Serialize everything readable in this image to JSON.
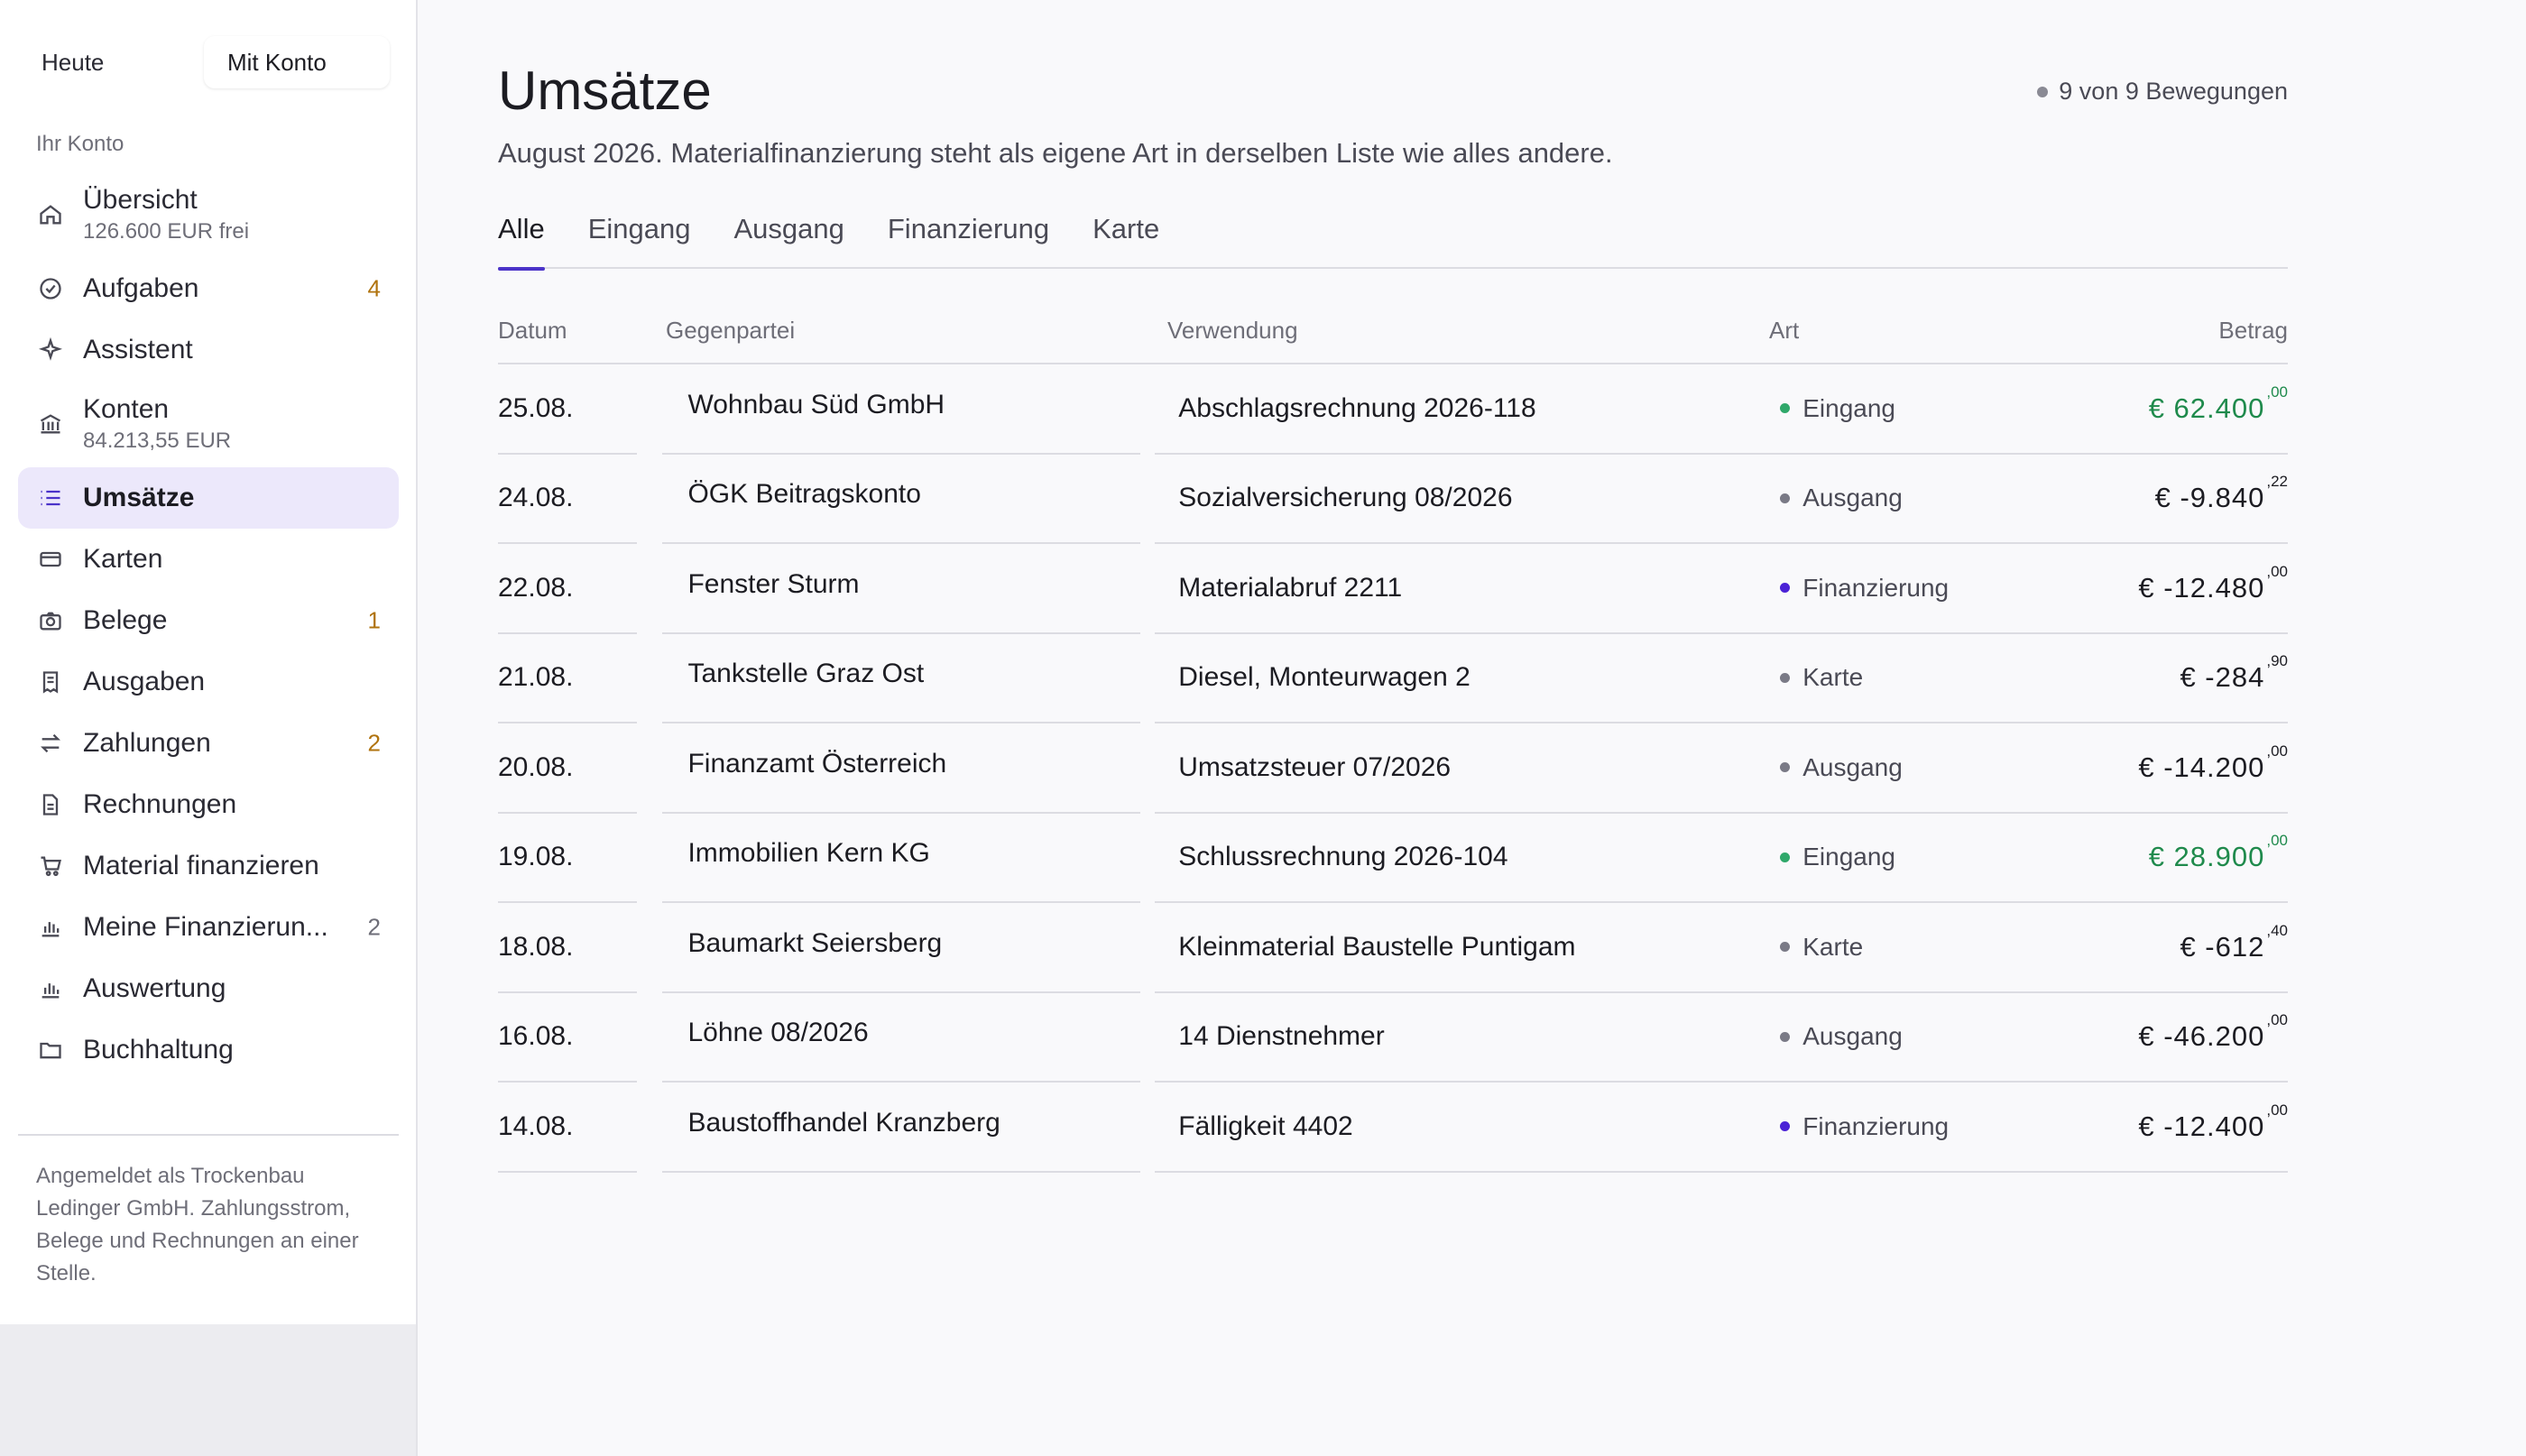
{
  "colors": {
    "accent": "#4b33c9",
    "positive": "#1f8a4c",
    "badge": "#b0730e",
    "dot_eingang": "#2fa86a",
    "dot_ausgang": "#7a7a86",
    "dot_finanzierung": "#4b22d6",
    "dot_karte": "#7a7a86"
  },
  "sidebar": {
    "mode": {
      "today": "Heute",
      "with_account": "Mit Konto"
    },
    "section_label": "Ihr Konto",
    "items": [
      {
        "label": "Übersicht",
        "sub": "126.600 EUR frei",
        "badge": "",
        "icon": "home-icon"
      },
      {
        "label": "Aufgaben",
        "sub": "",
        "badge": "4",
        "icon": "check-circle-icon"
      },
      {
        "label": "Assistent",
        "sub": "",
        "badge": "",
        "icon": "sparkle-icon"
      },
      {
        "label": "Konten",
        "sub": "84.213,55 EUR",
        "badge": "",
        "icon": "bank-icon"
      },
      {
        "label": "Umsätze",
        "sub": "",
        "badge": "",
        "icon": "list-icon"
      },
      {
        "label": "Karten",
        "sub": "",
        "badge": "",
        "icon": "card-icon"
      },
      {
        "label": "Belege",
        "sub": "",
        "badge": "1",
        "icon": "camera-icon"
      },
      {
        "label": "Ausgaben",
        "sub": "",
        "badge": "",
        "icon": "receipt-icon"
      },
      {
        "label": "Zahlungen",
        "sub": "",
        "badge": "2",
        "icon": "transfer-icon"
      },
      {
        "label": "Rechnungen",
        "sub": "",
        "badge": "",
        "icon": "document-icon"
      },
      {
        "label": "Material finanzieren",
        "sub": "",
        "badge": "",
        "icon": "cart-icon"
      },
      {
        "label": "Meine Finanzierun...",
        "sub": "",
        "badge": "2",
        "icon": "bar-chart-icon"
      },
      {
        "label": "Auswertung",
        "sub": "",
        "badge": "",
        "icon": "bar-chart-icon"
      },
      {
        "label": "Buchhaltung",
        "sub": "",
        "badge": "",
        "icon": "folder-icon"
      }
    ],
    "note": "Angemeldet als Trockenbau Ledinger GmbH. Zahlungsstrom, Belege und Rechnungen an einer Stelle."
  },
  "main": {
    "title": "Umsätze",
    "count": "9 von 9 Bewegungen",
    "subtitle": "August 2026. Materialfinanzierung steht als eigene Art in derselben Liste wie alles andere.",
    "tabs": [
      "Alle",
      "Eingang",
      "Ausgang",
      "Finanzierung",
      "Karte"
    ],
    "columns": {
      "date": "Datum",
      "party": "Gegenpartei",
      "purpose": "Verwendung",
      "type": "Art",
      "amount": "Betrag"
    },
    "rows": [
      {
        "date": "25.08.",
        "party": "Wohnbau Süd GmbH",
        "purpose": "Abschlagsrechnung 2026-118",
        "type": "Eingang",
        "amount": "€ 62.400",
        "cents": ",00"
      },
      {
        "date": "24.08.",
        "party": "ÖGK Beitragskonto",
        "purpose": "Sozialversicherung 08/2026",
        "type": "Ausgang",
        "amount": "€ -9.840",
        "cents": ",22"
      },
      {
        "date": "22.08.",
        "party": "Fenster Sturm",
        "purpose": "Materialabruf 2211",
        "type": "Finanzierung",
        "amount": "€ -12.480",
        "cents": ",00"
      },
      {
        "date": "21.08.",
        "party": "Tankstelle Graz Ost",
        "purpose": "Diesel, Monteurwagen 2",
        "type": "Karte",
        "amount": "€ -284",
        "cents": ",90"
      },
      {
        "date": "20.08.",
        "party": "Finanzamt Österreich",
        "purpose": "Umsatzsteuer 07/2026",
        "type": "Ausgang",
        "amount": "€ -14.200",
        "cents": ",00"
      },
      {
        "date": "19.08.",
        "party": "Immobilien Kern KG",
        "purpose": "Schlussrechnung 2026-104",
        "type": "Eingang",
        "amount": "€ 28.900",
        "cents": ",00"
      },
      {
        "date": "18.08.",
        "party": "Baumarkt Seiersberg",
        "purpose": "Kleinmaterial Baustelle Puntigam",
        "type": "Karte",
        "amount": "€ -612",
        "cents": ",40"
      },
      {
        "date": "16.08.",
        "party": "Löhne 08/2026",
        "purpose": "14 Dienstnehmer",
        "type": "Ausgang",
        "amount": "€ -46.200",
        "cents": ",00"
      },
      {
        "date": "14.08.",
        "party": "Baustoffhandel Kranzberg",
        "purpose": "Fälligkeit 4402",
        "type": "Finanzierung",
        "amount": "€ -12.400",
        "cents": ",00"
      }
    ]
  }
}
